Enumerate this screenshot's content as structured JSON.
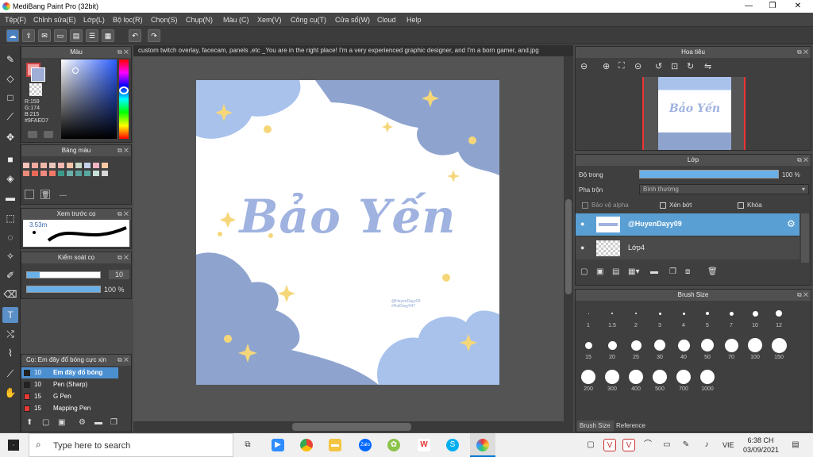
{
  "window": {
    "title": "MediBang Paint Pro (32bit)",
    "min": "—",
    "max": "❐",
    "close": "✕"
  },
  "menu": [
    "Tệp(F)",
    "Chỉnh sửa(E)",
    "Lớp(L)",
    "Bộ lọc(R)",
    "Chọn(S)",
    "Chụp(N)",
    "Màu (C)",
    "Xem(V)",
    "Công cụ(T)",
    "Cửa sổ(W)",
    "Cloud",
    "Help"
  ],
  "color_panel": {
    "title": "Màu",
    "r": "R:159",
    "g": "G:174",
    "b": "B:215",
    "hex": "#9FAED7"
  },
  "palette_panel": {
    "title": "Bảng màu",
    "dash": "---"
  },
  "brush_preview": {
    "title": "Xem trước cọ",
    "size": "3.53m"
  },
  "brush_control": {
    "title": "Kiểm soát cọ",
    "size_value": "10",
    "opacity_value": "100 %"
  },
  "brush_list": {
    "title": "Cọ: Em đây đổ bóng cực xịn",
    "items": [
      {
        "size": "10",
        "name": "Em đây đổ bóng",
        "color": "#222222"
      },
      {
        "size": "10",
        "name": "Pen (Sharp)",
        "color": "#222222"
      },
      {
        "size": "15",
        "name": "G Pen",
        "color": "#e53935"
      },
      {
        "size": "15",
        "name": "Mapping Pen",
        "color": "#e53935"
      }
    ]
  },
  "document": {
    "tab_text": "custom twitch overlay, facecam, panels ,etc _You are in the right place! I'm a very experienced graphic designer, and I'm a born gamer, and.jpg"
  },
  "artwork": {
    "title": "Bảo Yến",
    "credit_line1": "@HuyenDayy09",
    "credit_line2": "#HuiDayy047"
  },
  "navigator": {
    "title": "Hoa tiêu",
    "thumb_text": "Bảo Yến"
  },
  "layer_panel": {
    "title": "Lớp",
    "opacity_label": "Độ trong",
    "opacity_value": "100 %",
    "blend_label": "Pha trộn",
    "blend_value": "Bình thường",
    "protect_alpha": "Bảo vệ alpha",
    "clipping": "Xén bớt",
    "lock": "Khóa",
    "layers": [
      {
        "name": "@HuyenDayy09",
        "active": true
      },
      {
        "name": "Lớp4",
        "active": false
      }
    ]
  },
  "brush_size_panel": {
    "title": "Brush Size",
    "sizes": [
      "1",
      "1.5",
      "2",
      "3",
      "4",
      "5",
      "7",
      "10",
      "12",
      "15",
      "20",
      "25",
      "30",
      "40",
      "50",
      "70",
      "100",
      "150",
      "200",
      "300",
      "400",
      "500",
      "700",
      "1000"
    ],
    "tabs": [
      "Brush Size",
      "Reference"
    ]
  },
  "taskbar": {
    "search_placeholder": "Type here to search",
    "lang": "VIE",
    "time": "6:38 CH",
    "date": "03/09/2021"
  },
  "colors": {
    "accent": "#5a9fd4",
    "art_blue": "#9fb2e0",
    "cloud_dark": "#8ea4cf",
    "cloud_light": "#a9c2ec",
    "sparkle": "#f5d77a"
  }
}
